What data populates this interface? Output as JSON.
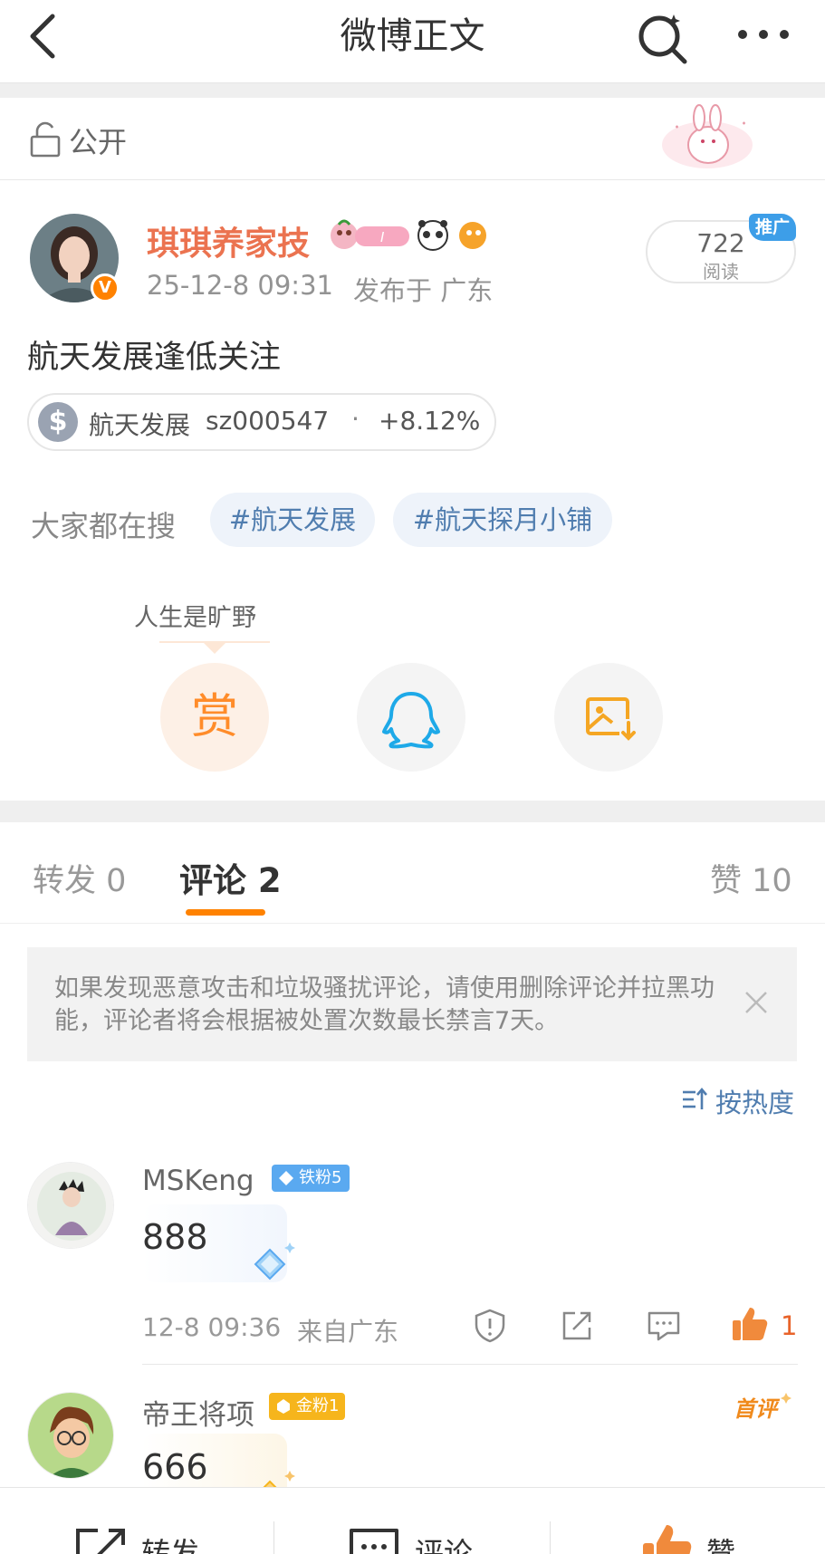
{
  "header": {
    "title": "微博正文"
  },
  "visibility": {
    "label": "公开"
  },
  "post": {
    "author": "琪琪养家技",
    "date": "25-12-8 09:31",
    "from": "发布于 广东",
    "read_count": "722",
    "read_label": "阅读",
    "promo_tag": "推广",
    "text": "航天发展逢低关注",
    "stock": {
      "icon": "$",
      "name": "航天发展",
      "code": "sz000547",
      "separator": "·",
      "change": "+8.12%"
    },
    "search_label": "大家都在搜",
    "topics": [
      "#航天发展",
      "#航天探月小铺"
    ],
    "reward_tip": "人生是旷野",
    "reward_label": "赏"
  },
  "tabs": {
    "repost": "转发 0",
    "comment": "评论 2",
    "like": "赞 10"
  },
  "notice": {
    "text": "如果发现恶意攻击和垃圾骚扰评论，请使用删除评论并拉黑功能，评论者将会根据被处置次数最长禁言7天。"
  },
  "sort": {
    "label": "按热度"
  },
  "comments": [
    {
      "user": "MSKeng",
      "badge": "铁粉5",
      "text": "888",
      "time": "12-8 09:36",
      "from": "来自广东",
      "likes": "1"
    },
    {
      "user": "帝王将项",
      "badge": "金粉1",
      "text": "666",
      "tag": "首评"
    }
  ],
  "bottom_bar": {
    "repost": "转发",
    "comment": "评论",
    "like": "赞"
  },
  "colors": {
    "accent": "#ff8200",
    "author": "#eb7350",
    "link": "#507daf",
    "like_red": "#e8632a"
  },
  "icons": [
    "back-icon",
    "search-icon",
    "more-icon",
    "lock-icon",
    "qq-icon",
    "save-image-icon",
    "close-icon",
    "sort-icon",
    "report-icon",
    "share-icon",
    "reply-icon",
    "like-icon"
  ]
}
